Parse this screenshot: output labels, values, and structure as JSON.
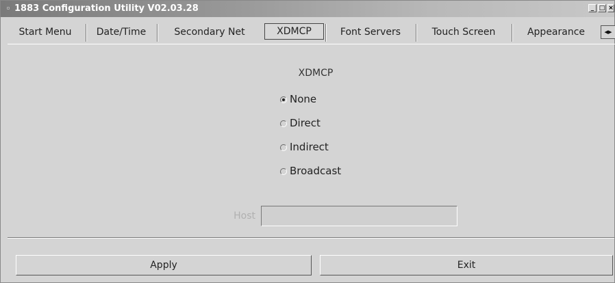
{
  "window": {
    "title": "1883 Configuration Utility V02.03.28"
  },
  "tabs": [
    {
      "label": "Start Menu"
    },
    {
      "label": "Date/Time"
    },
    {
      "label": "Secondary Net"
    },
    {
      "label": "XDMCP"
    },
    {
      "label": "Font Servers"
    },
    {
      "label": "Touch Screen"
    },
    {
      "label": "Appearance"
    }
  ],
  "active_tab": "XDMCP",
  "xdmcp": {
    "title": "XDMCP",
    "options": [
      {
        "label": "None",
        "selected": true
      },
      {
        "label": "Direct",
        "selected": false
      },
      {
        "label": "Indirect",
        "selected": false
      },
      {
        "label": "Broadcast",
        "selected": false
      }
    ],
    "host_label": "Host",
    "host_value": ""
  },
  "buttons": {
    "apply": "Apply",
    "exit": "Exit"
  }
}
